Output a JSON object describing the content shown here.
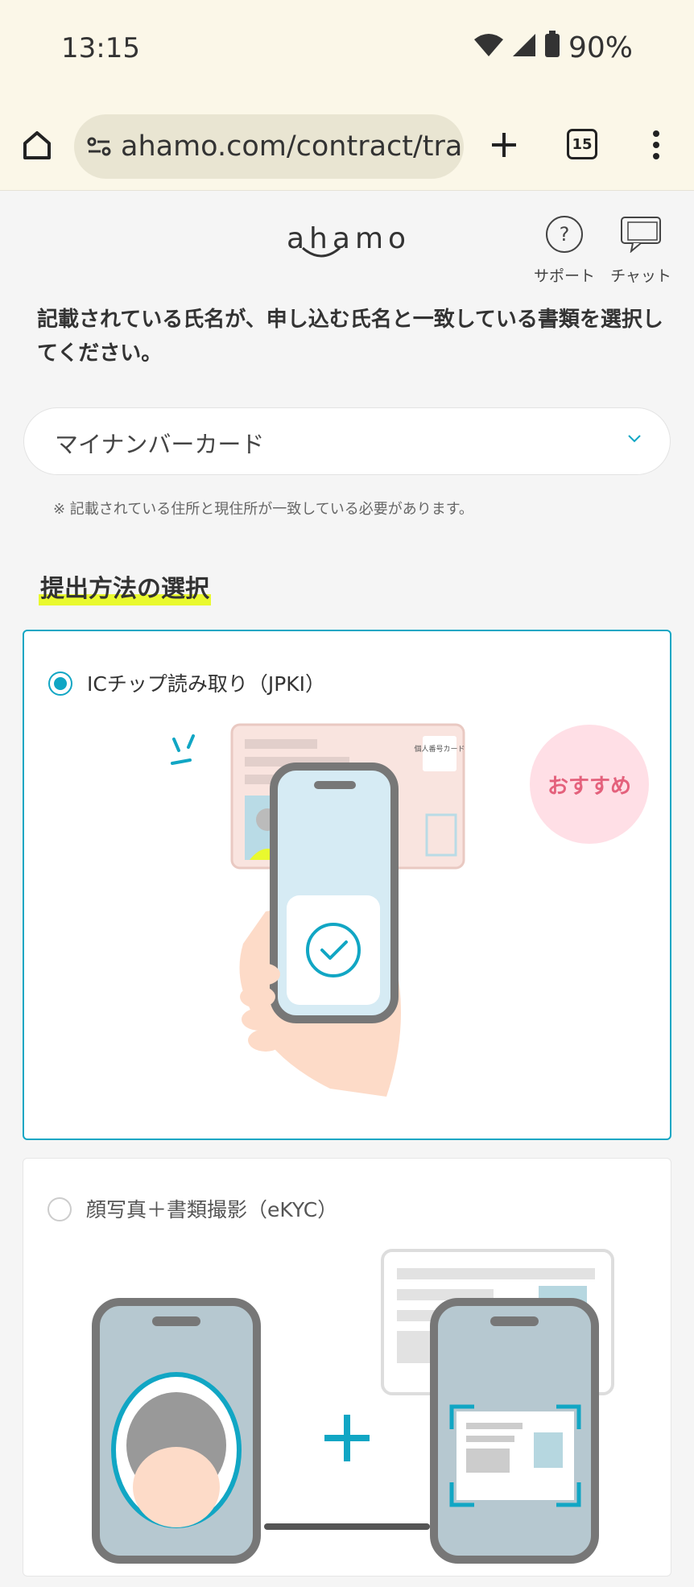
{
  "status_bar": {
    "time": "13:15",
    "battery": "90%",
    "icons": [
      "wifi-icon",
      "signal-icon",
      "battery-icon"
    ]
  },
  "browser": {
    "url": "ahamo.com/contract/tra/a",
    "tab_count": "15",
    "icons": [
      "home-icon",
      "site-info-icon",
      "new-tab-icon",
      "tabs-icon",
      "menu-icon"
    ]
  },
  "header": {
    "logo": "ahamo",
    "support_label": "サポート",
    "chat_label": "チャット"
  },
  "instruction": "記載されている氏名が、申し込む氏名と一致している書類を選択してください。",
  "document_select": {
    "value": "マイナンバーカード"
  },
  "note": "※ 記載されている住所と現住所が一致している必要があります。",
  "section_title": "提出方法の選択",
  "options": [
    {
      "label": "ICチップ読み取り（JPKI）",
      "selected": true,
      "badge": "おすすめ",
      "card_text": "個人番号カード"
    },
    {
      "label": "顔写真＋書類撮影（eKYC）",
      "selected": false
    }
  ],
  "colors": {
    "accent": "#11a6c4",
    "highlight": "#e9f92e",
    "badge_bg": "#ffdfe6",
    "badge_text": "#e4617c",
    "browser_bg": "#fbf7e8"
  }
}
